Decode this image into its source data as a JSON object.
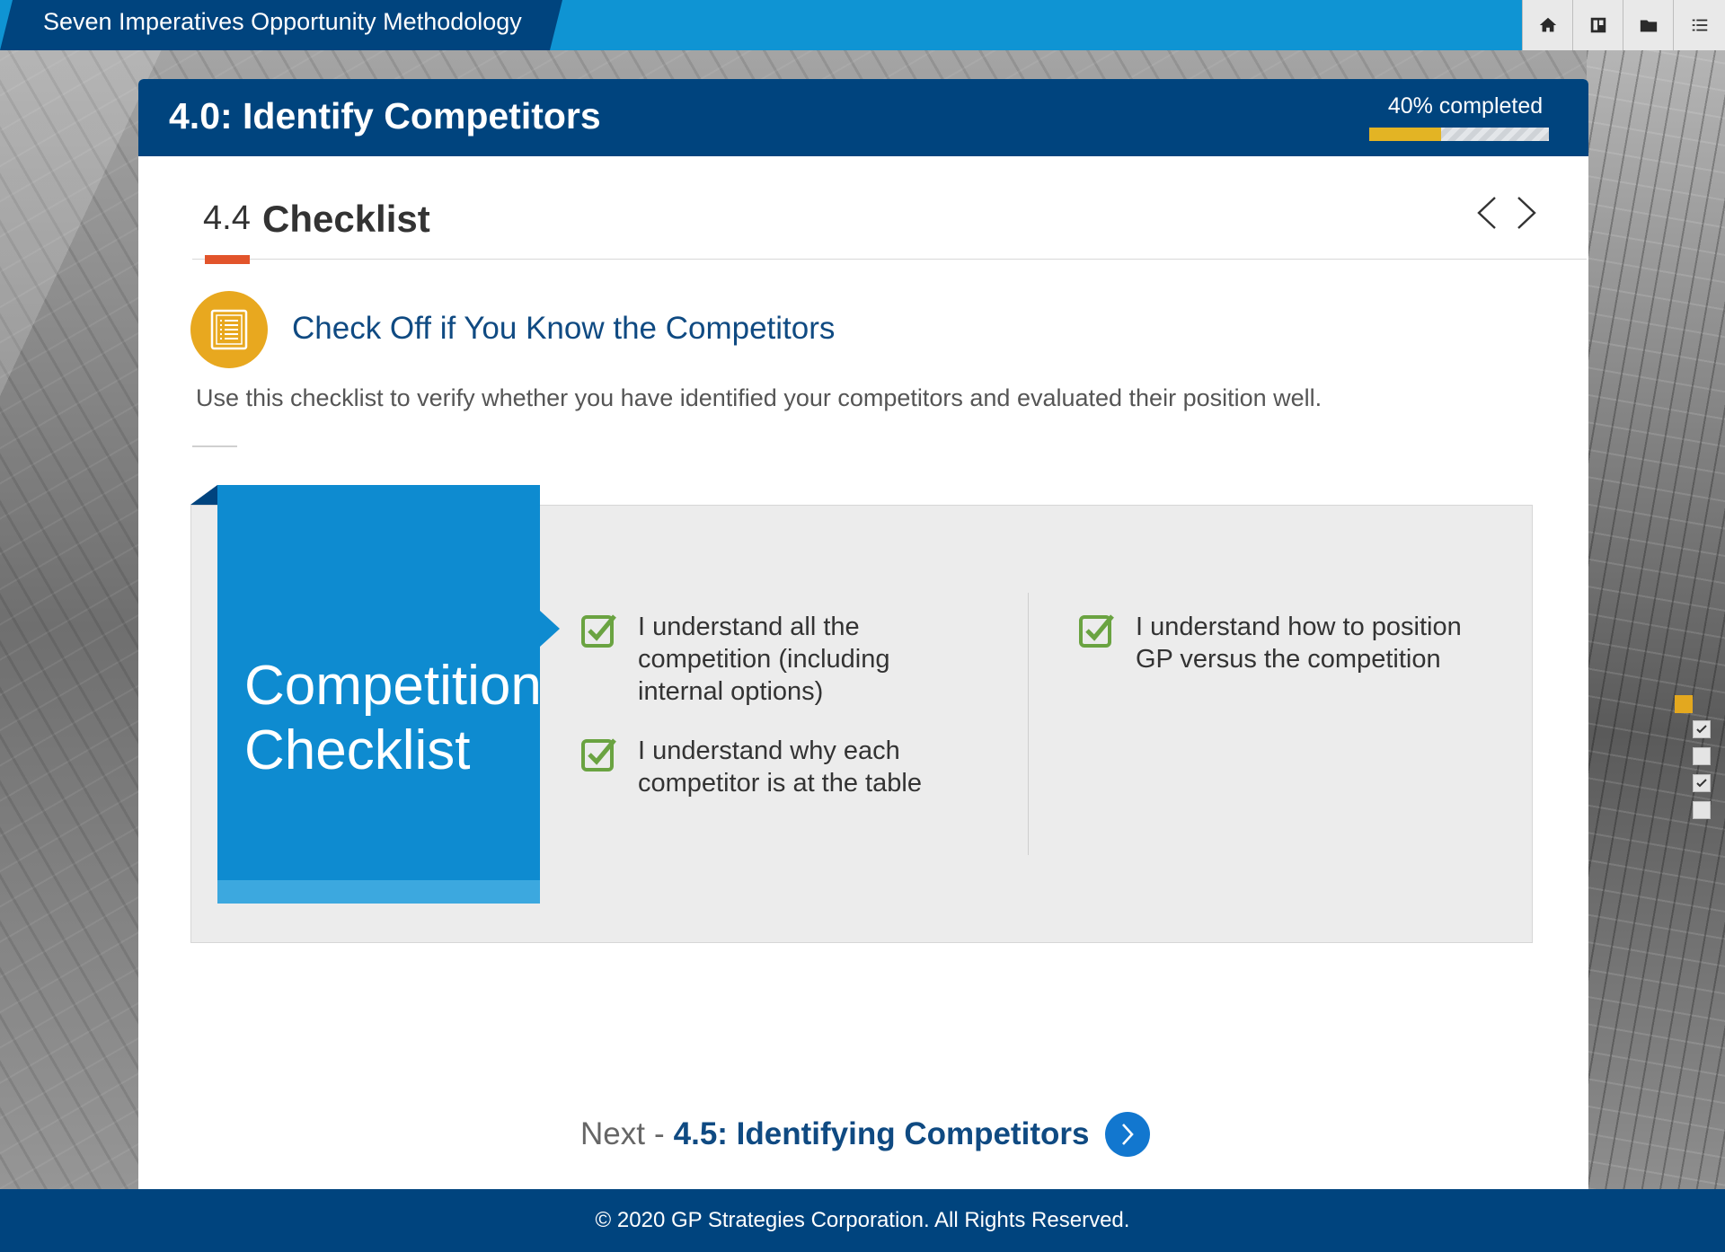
{
  "app": {
    "title": "Seven Imperatives Opportunity Methodology"
  },
  "toolbar": {
    "buttons": [
      {
        "icon": "home-icon"
      },
      {
        "icon": "glossary-icon"
      },
      {
        "icon": "folder-icon"
      },
      {
        "icon": "menu-list-icon"
      }
    ]
  },
  "module": {
    "title": "4.0: Identify Competitors",
    "progress_label": "40% completed",
    "progress_percent": 40
  },
  "section": {
    "number": "4.4",
    "name": "Checklist"
  },
  "intro": {
    "icon": "checklist-icon",
    "heading": "Check Off if You Know the Competitors",
    "text": "Use this checklist to verify whether you have identified your competitors and evaluated their position well."
  },
  "checklist": {
    "title_line1": "Competition",
    "title_line2": "Checklist",
    "items": [
      {
        "line1": "I understand all the",
        "line2": "competition (including",
        "line3": "internal options)"
      },
      {
        "line1": "I understand why each",
        "line2": "competitor is at the table"
      },
      {
        "line1": "I understand how to position",
        "line2": "GP versus the competition"
      }
    ],
    "accent_color": "#6aa341"
  },
  "next": {
    "label": "Next",
    "separator": "-",
    "target": "4.5: Identifying Competitors"
  },
  "footer": {
    "text": "© 2020 GP Strategies Corporation. All Rights Reserved."
  },
  "colors": {
    "brand_dark": "#00447e",
    "brand_light": "#0f94d3",
    "accent_orange": "#e2542b",
    "accent_gold": "#e3b424"
  }
}
